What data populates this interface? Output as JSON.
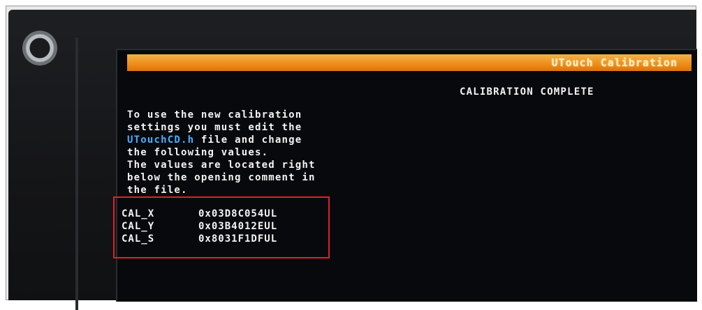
{
  "screen": {
    "title": "UTouch Calibration",
    "heading": "CALIBRATION COMPLETE",
    "instructions": {
      "line1": "To use the new calibration",
      "line2": "settings you must edit the",
      "line3_file": "UTouchCD.h",
      "line3_rest": " file and change",
      "line4": "the following values.",
      "line5": "The values are located right",
      "line6": "below the opening comment in",
      "line7": "the file."
    },
    "values": [
      {
        "label": "CAL_X",
        "value": "0x03D8C054UL"
      },
      {
        "label": "CAL_Y",
        "value": "0x03B4012EUL"
      },
      {
        "label": "CAL_S",
        "value": "0x8031F1DFUL"
      }
    ]
  },
  "colors": {
    "title_bar": "#ee8f1c",
    "text": "#f3f3f3",
    "file_name": "#4ab0ff",
    "highlight": "#e0202a",
    "screen_bg": "#07090c"
  }
}
